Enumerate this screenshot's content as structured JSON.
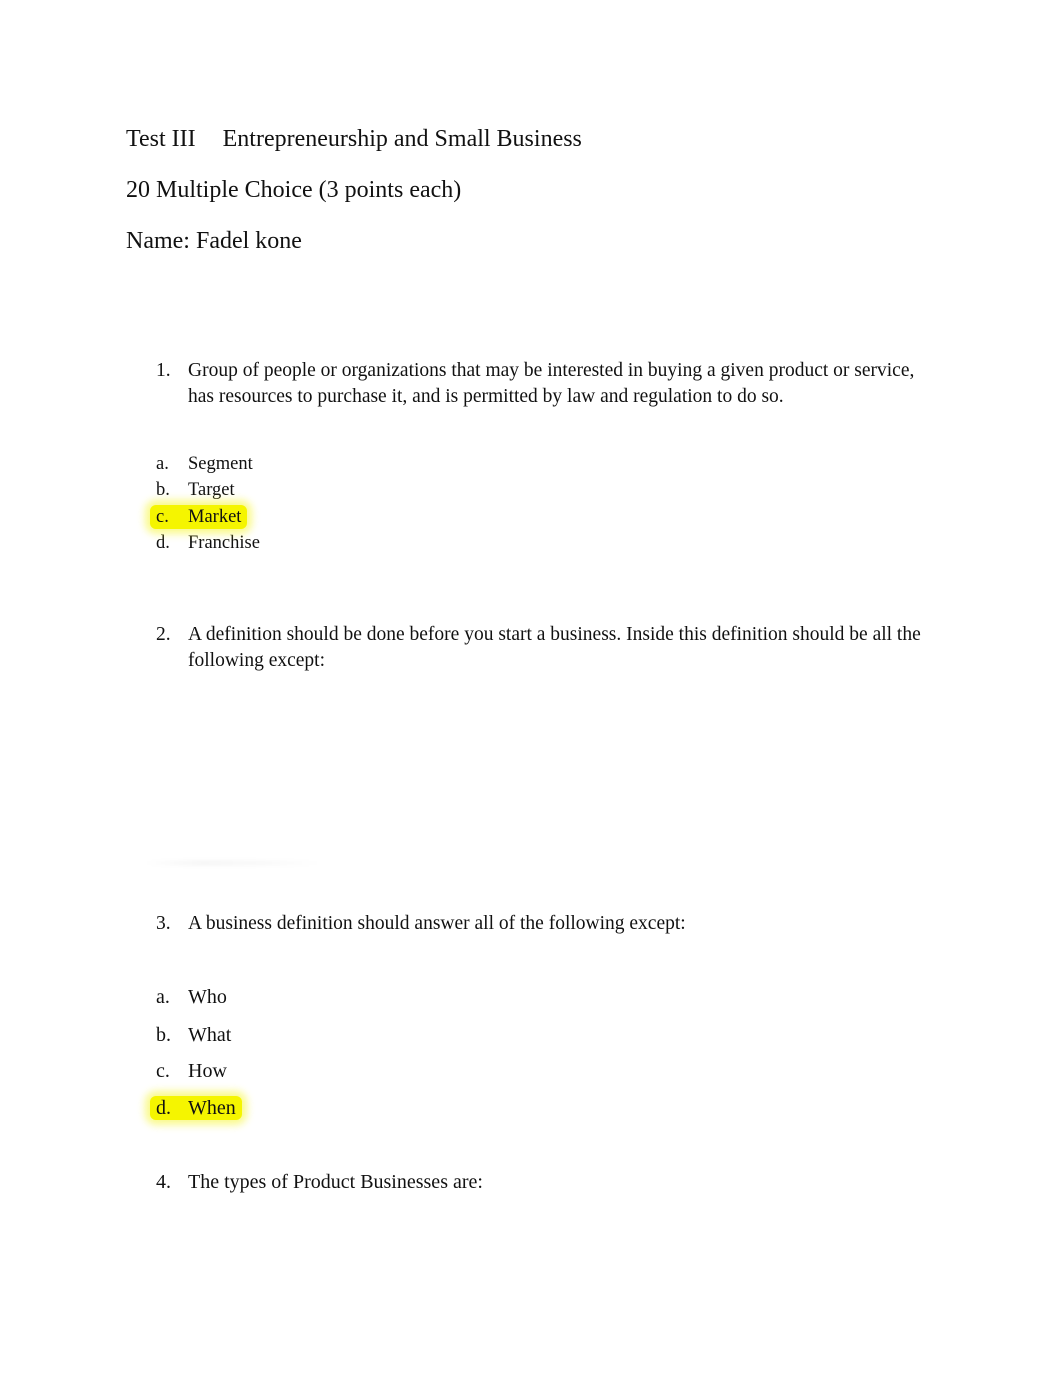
{
  "header": {
    "test_label": "Test III",
    "course_title": "Entrepreneurship and Small Business",
    "instructions": "20 Multiple Choice (3 points each)",
    "name_line": "Name: Fadel kone"
  },
  "highlight_color": "#f5f500",
  "questions": [
    {
      "number": "1.",
      "text": "Group of people or organizations that may be interested in buying a given product or service, has resources to purchase it, and is permitted by law and regulation to do so.",
      "options": [
        {
          "letter": "a.",
          "text": "Segment",
          "highlighted": false
        },
        {
          "letter": "b.",
          "text": "Target",
          "highlighted": false
        },
        {
          "letter": "c.",
          "text": "Market",
          "highlighted": true
        },
        {
          "letter": "d.",
          "text": "Franchise",
          "highlighted": false
        }
      ]
    },
    {
      "number": "2.",
      "text": "A definition should be done before you start a business. Inside this definition should be all the following except:",
      "options": []
    },
    {
      "number": "3.",
      "text": "A business definition should answer all of the following except:",
      "options": [
        {
          "letter": "a.",
          "text": "Who",
          "highlighted": false
        },
        {
          "letter": "b.",
          "text": "What",
          "highlighted": false
        },
        {
          "letter": "c.",
          "text": "How",
          "highlighted": false
        },
        {
          "letter": "d.",
          "text": "When",
          "highlighted": true
        }
      ]
    },
    {
      "number": "4.",
      "text": "The types of Product Businesses are:",
      "options": []
    }
  ]
}
